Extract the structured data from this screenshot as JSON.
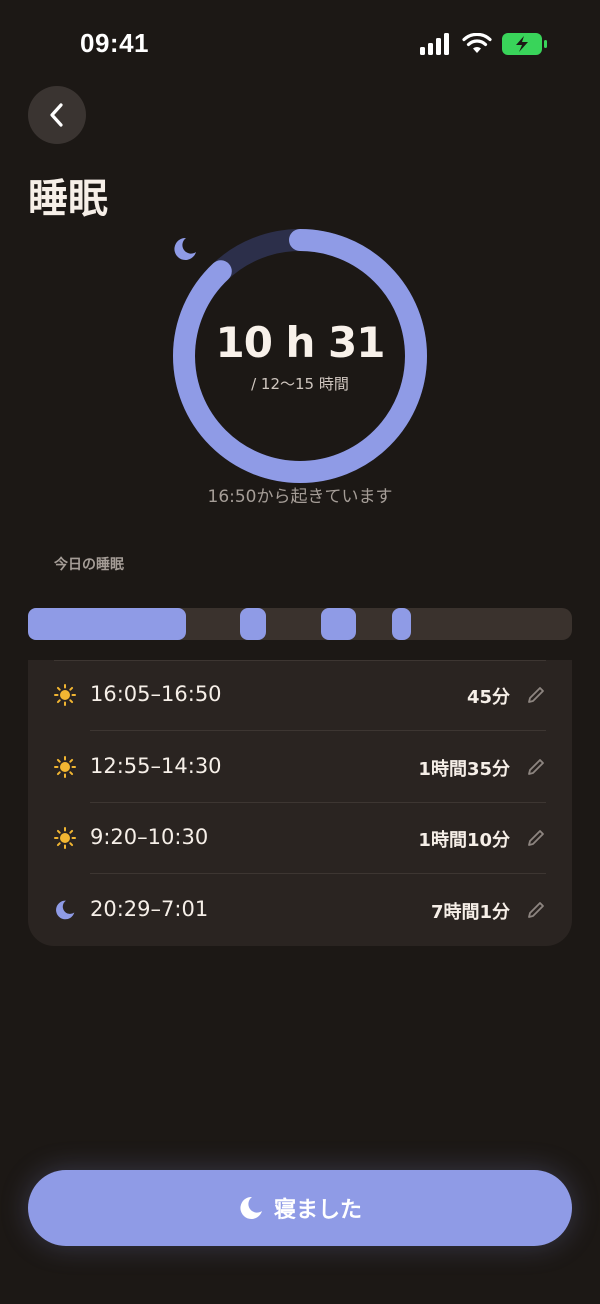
{
  "status_bar": {
    "time": "09:41"
  },
  "header": {
    "title": "睡眠"
  },
  "summary": {
    "duration": "10 h 31",
    "goal": "/ 12〜15 時間",
    "awake_since": "16:50から起きています",
    "progress_fraction": 0.88
  },
  "today": {
    "label": "今日の睡眠",
    "timeline_segments": [
      {
        "start_fraction": 0.0,
        "end_fraction": 0.29
      },
      {
        "start_fraction": 0.389,
        "end_fraction": 0.438
      },
      {
        "start_fraction": 0.538,
        "end_fraction": 0.603
      },
      {
        "start_fraction": 0.67,
        "end_fraction": 0.704
      }
    ],
    "entries": [
      {
        "icon": "sun-icon",
        "time": "16:05–16:50",
        "duration": "45分"
      },
      {
        "icon": "sun-icon",
        "time": "12:55–14:30",
        "duration": "1時間35分"
      },
      {
        "icon": "sun-icon",
        "time": "9:20–10:30",
        "duration": "1時間10分"
      },
      {
        "icon": "moon-icon",
        "time": "20:29–7:01",
        "duration": "7時間1分"
      }
    ]
  },
  "action": {
    "label": "寝ました",
    "icon": "moon-icon"
  },
  "colors": {
    "accent": "#8f9be6",
    "ring_track": "#2c2f4a",
    "background": "#1c1815",
    "card": "#2a2421",
    "sun": "#f2b632",
    "battery": "#39d45a"
  }
}
